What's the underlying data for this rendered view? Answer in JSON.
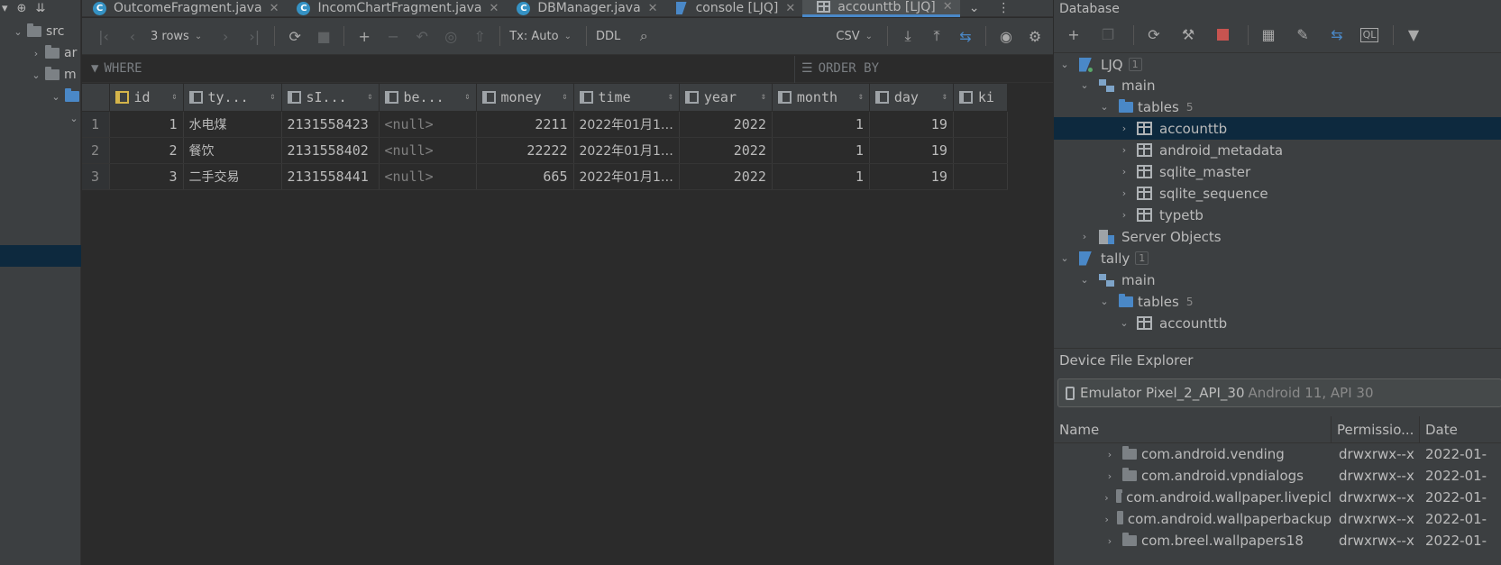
{
  "project": {
    "tree": [
      {
        "label": "src",
        "expanded": true
      },
      {
        "label": "ar",
        "expanded": false
      },
      {
        "label": "m",
        "expanded": true
      },
      {
        "label": "",
        "expanded": true
      },
      {
        "label": "",
        "expanded": true
      }
    ]
  },
  "tabs": [
    {
      "label": "OutcomeFragment.java",
      "icon": "class-icon",
      "active": false
    },
    {
      "label": "IncomChartFragment.java",
      "icon": "class-icon",
      "active": false
    },
    {
      "label": "DBManager.java",
      "icon": "class-icon",
      "active": false
    },
    {
      "label": "console [LJQ]",
      "icon": "console-icon",
      "active": false
    },
    {
      "label": "accounttb [LJQ]",
      "icon": "table-icon",
      "active": true
    }
  ],
  "toolbar": {
    "rows_label": "3 rows",
    "tx_label": "Tx: Auto",
    "ddl_label": "DDL",
    "export_format": "CSV"
  },
  "filter": {
    "where_placeholder": "WHERE",
    "order_placeholder": "ORDER BY"
  },
  "grid": {
    "columns": [
      "id",
      "ty...",
      "sI...",
      "be...",
      "money",
      "time",
      "year",
      "month",
      "day",
      "ki"
    ],
    "rows": [
      {
        "num": "1",
        "id": "1",
        "type": "水电煤",
        "simage": "2131558423",
        "beizhu": "<null>",
        "money": "2211",
        "time": "2022年01月1…",
        "year": "2022",
        "month": "1",
        "day": "19"
      },
      {
        "num": "2",
        "id": "2",
        "type": "餐饮",
        "simage": "2131558402",
        "beizhu": "<null>",
        "money": "22222",
        "time": "2022年01月1…",
        "year": "2022",
        "month": "1",
        "day": "19"
      },
      {
        "num": "3",
        "id": "3",
        "type": "二手交易",
        "simage": "2131558441",
        "beizhu": "<null>",
        "money": "665",
        "time": "2022年01月1…",
        "year": "2022",
        "month": "1",
        "day": "19"
      }
    ]
  },
  "database": {
    "title": "Database",
    "tree": [
      {
        "label": "LJQ",
        "badge": "1",
        "kind": "datasource"
      },
      {
        "label": "main",
        "kind": "schema"
      },
      {
        "label": "tables",
        "count": "5",
        "kind": "folder"
      },
      {
        "label": "accounttb",
        "kind": "table",
        "selected": true
      },
      {
        "label": "android_metadata",
        "kind": "table"
      },
      {
        "label": "sqlite_master",
        "kind": "table"
      },
      {
        "label": "sqlite_sequence",
        "kind": "table"
      },
      {
        "label": "typetb",
        "kind": "table"
      },
      {
        "label": "Server Objects",
        "kind": "server"
      },
      {
        "label": "tally",
        "badge": "1",
        "kind": "datasource"
      },
      {
        "label": "main",
        "kind": "schema"
      },
      {
        "label": "tables",
        "count": "5",
        "kind": "folder"
      },
      {
        "label": "accounttb",
        "kind": "table"
      }
    ]
  },
  "device_explorer": {
    "title": "Device File Explorer",
    "device_name": "Emulator Pixel_2_API_30",
    "device_info": "Android 11, API 30",
    "columns": [
      "Name",
      "Permissio...",
      "Date"
    ],
    "files": [
      {
        "name": "com.android.vending",
        "perm": "drwxrwx--x",
        "date": "2022-01-"
      },
      {
        "name": "com.android.vpndialogs",
        "perm": "drwxrwx--x",
        "date": "2022-01-"
      },
      {
        "name": "com.android.wallpaper.livepicl",
        "perm": "drwxrwx--x",
        "date": "2022-01-"
      },
      {
        "name": "com.android.wallpaperbackup",
        "perm": "drwxrwx--x",
        "date": "2022-01-"
      },
      {
        "name": "com.breel.wallpapers18",
        "perm": "drwxrwx--x",
        "date": "2022-01-"
      }
    ]
  }
}
